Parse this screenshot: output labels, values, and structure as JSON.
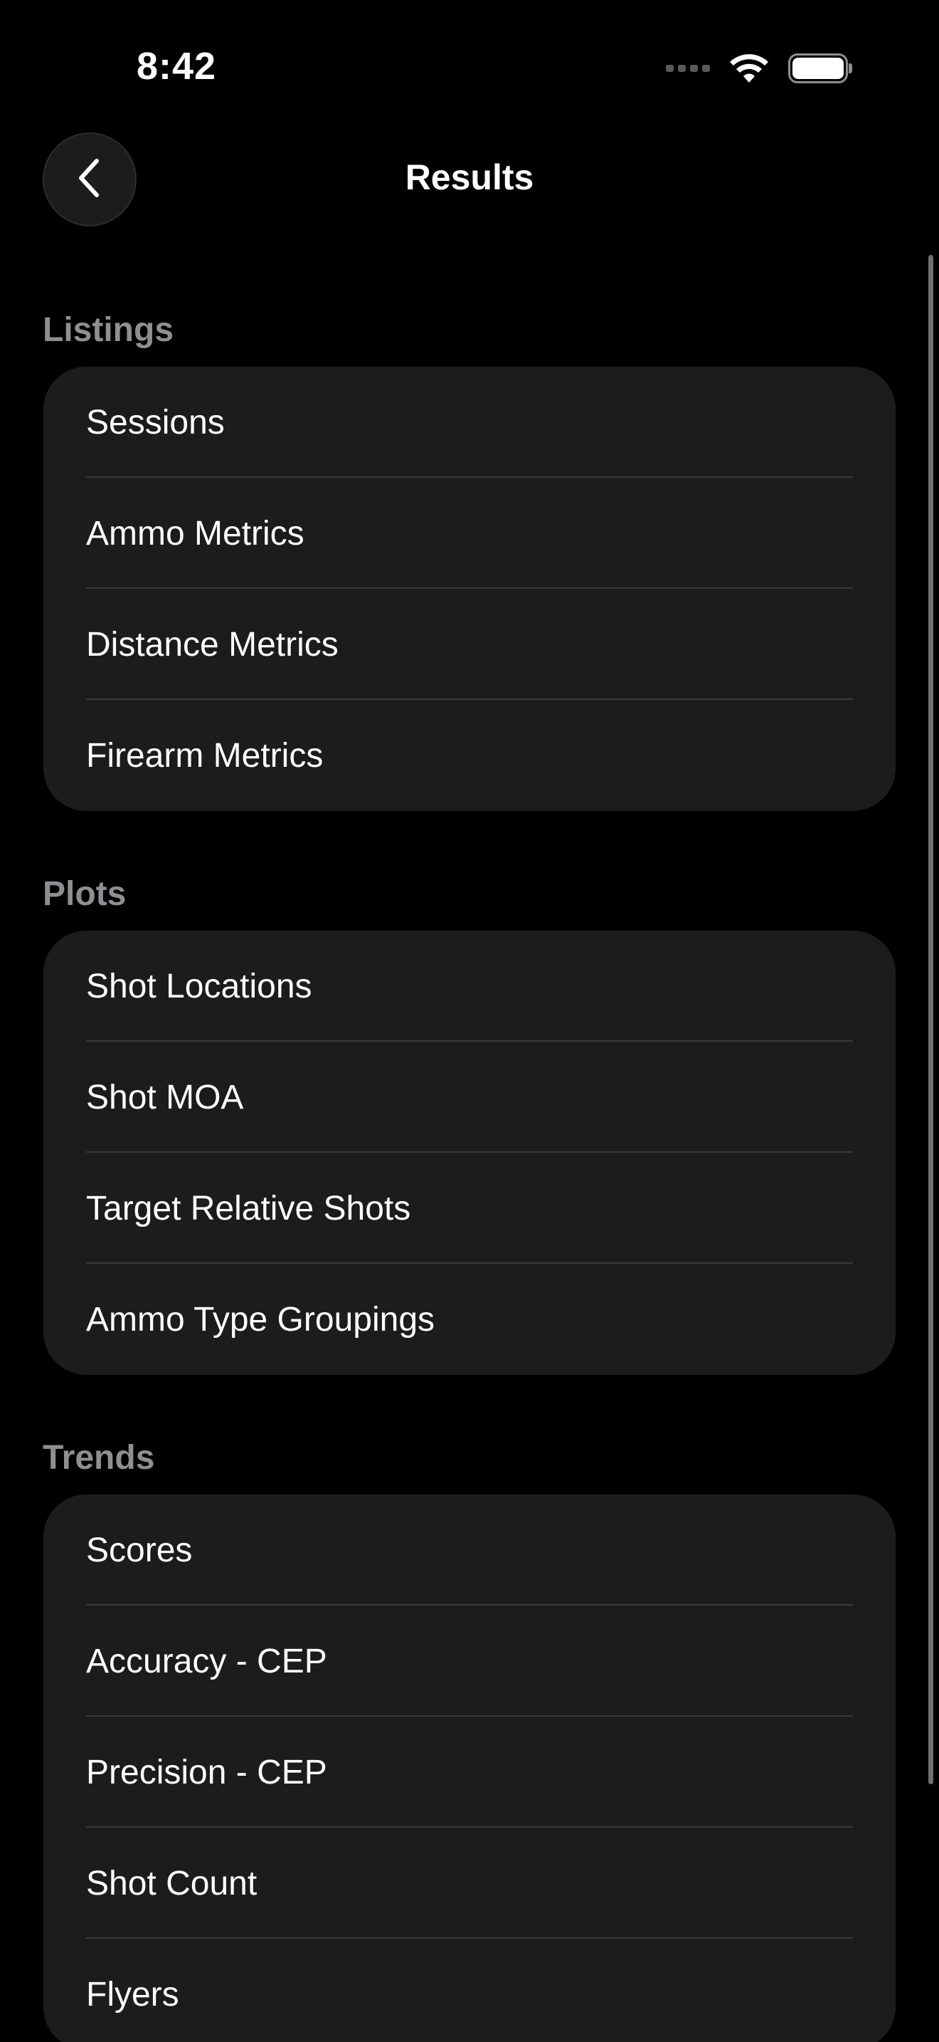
{
  "status_bar": {
    "time": "8:42"
  },
  "nav": {
    "title": "Results"
  },
  "sections": {
    "listings": {
      "header": "Listings",
      "items": [
        "Sessions",
        "Ammo Metrics",
        "Distance Metrics",
        "Firearm Metrics"
      ]
    },
    "plots": {
      "header": "Plots",
      "items": [
        "Shot Locations",
        "Shot MOA",
        "Target Relative Shots",
        "Ammo Type Groupings"
      ]
    },
    "trends": {
      "header": "Trends",
      "items": [
        "Scores",
        "Accuracy - CEP",
        "Precision - CEP",
        "Shot Count",
        "Flyers"
      ]
    }
  }
}
